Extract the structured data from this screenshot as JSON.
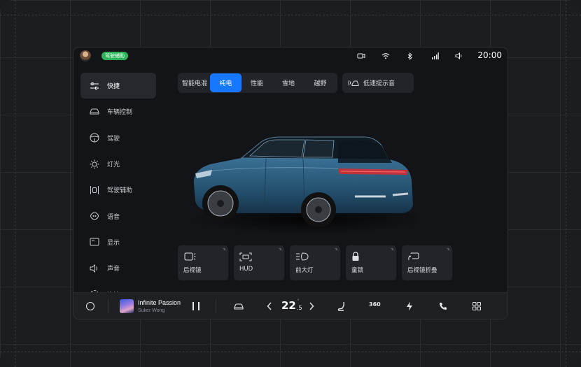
{
  "status_bar": {
    "badge": "驾驶辅助",
    "time": "20:00",
    "icons": [
      "camera-icon",
      "wifi-icon",
      "bluetooth-icon",
      "signal-icon",
      "volume-icon"
    ]
  },
  "sidebar": {
    "items": [
      {
        "label": "快捷",
        "icon": "sliders-icon",
        "active": true
      },
      {
        "label": "车辆控制",
        "icon": "car-icon"
      },
      {
        "label": "驾驶",
        "icon": "steering-wheel-icon"
      },
      {
        "label": "灯光",
        "icon": "light-icon"
      },
      {
        "label": "驾驶辅助",
        "icon": "lane-assist-icon"
      },
      {
        "label": "语音",
        "icon": "voice-icon"
      },
      {
        "label": "显示",
        "icon": "display-icon"
      },
      {
        "label": "声音",
        "icon": "speaker-icon"
      },
      {
        "label": "连接",
        "icon": "connect-icon"
      }
    ]
  },
  "modes": {
    "items": [
      "智能电混",
      "纯电",
      "性能",
      "雪地",
      "越野"
    ],
    "active": "纯电"
  },
  "low_speed_sound": {
    "label": "低速提示音"
  },
  "tiles": [
    {
      "label": "后视镜",
      "icon": "mirror-icon"
    },
    {
      "label": "HUD",
      "icon": "hud-icon"
    },
    {
      "label": "前大灯",
      "icon": "headlight-icon"
    },
    {
      "label": "童锁",
      "icon": "lock-icon"
    },
    {
      "label": "后视镜折叠",
      "icon": "mirror-fold-icon"
    }
  ],
  "media": {
    "title": "Infinite Passion",
    "artist": "Suker Wong"
  },
  "climate": {
    "temp_whole": "22",
    "temp_decimal": ".5",
    "degree": "°"
  },
  "dock": {
    "label_360": "360"
  },
  "colors": {
    "accent": "#1677ff",
    "badge": "#2eb35a",
    "car_body": "#24506e"
  }
}
